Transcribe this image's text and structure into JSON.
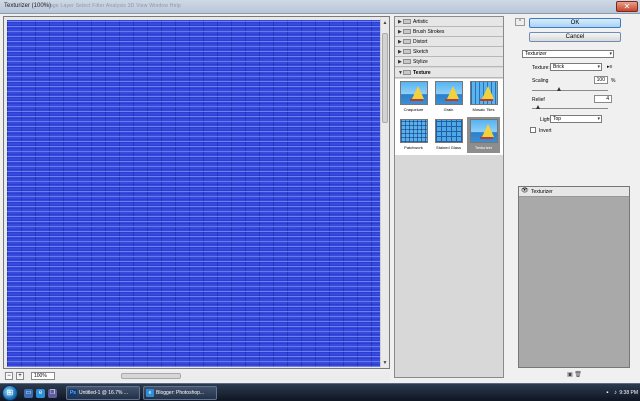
{
  "window": {
    "title": "Texturizer (100%)",
    "menu_ghost": "Image   Layer   Select   Filter   Analysis   3D   View   Window   Help",
    "close_glyph": "✕"
  },
  "preview": {
    "zoom": "100%",
    "minus": "−",
    "plus": "+"
  },
  "gallery": {
    "categories": [
      {
        "label": "Artistic",
        "open": false
      },
      {
        "label": "Brush Strokes",
        "open": false
      },
      {
        "label": "Distort",
        "open": false
      },
      {
        "label": "Sketch",
        "open": false
      },
      {
        "label": "Stylize",
        "open": false
      },
      {
        "label": "Texture",
        "open": true
      }
    ],
    "filters": [
      {
        "label": "Craquelure"
      },
      {
        "label": "Grain"
      },
      {
        "label": "Mosaic Tiles"
      },
      {
        "label": "Patchwork"
      },
      {
        "label": "Stained Glass"
      },
      {
        "label": "Texturizer",
        "selected": true
      }
    ]
  },
  "buttons": {
    "ok": "OK",
    "cancel": "Cancel"
  },
  "settings": {
    "filter_select": "Texturizer",
    "texture_label": "Texture:",
    "texture_value": "Brick",
    "scaling_label": "Scaling",
    "scaling_value": "100",
    "scaling_unit": "%",
    "relief_label": "Relief",
    "relief_value": "4",
    "light_label": "Light:",
    "light_value": "Top",
    "invert_label": "Invert",
    "invert_checked": false,
    "texture_menu_glyph": "▸≡"
  },
  "layers": {
    "row_label": "Texturizer",
    "eye_glyph": "👁"
  },
  "taskbar": {
    "start_glyph": "⊞",
    "tasks": [
      {
        "label": "Untitled-1 @ 16.7% ...",
        "icon": "Ps"
      },
      {
        "label": "Blogger: Photoshop...",
        "icon": "e"
      }
    ],
    "clock": "9:38 PM"
  },
  "colors": {
    "preview_blue": "#2b3fd8",
    "ok_button": "#a9d2f3",
    "taskbar": "#0e1522"
  }
}
